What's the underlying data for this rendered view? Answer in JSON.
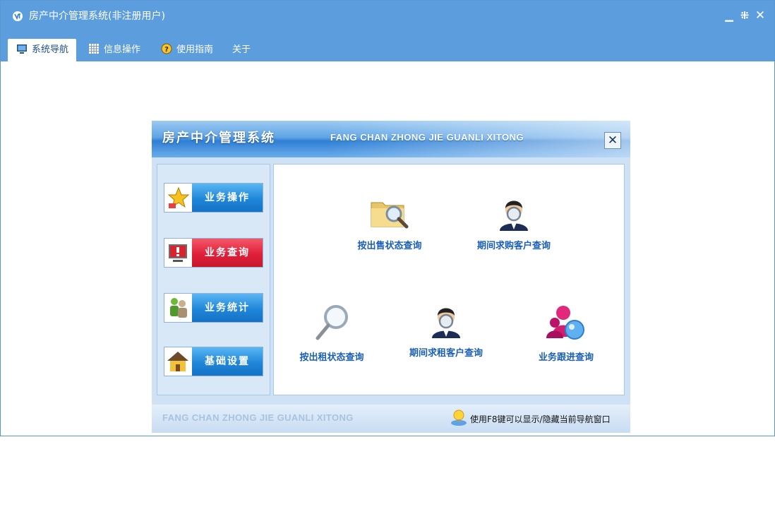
{
  "window": {
    "title": "房产中介管理系统(非注册用户)",
    "controls": {
      "minimize": "▁",
      "restore": "⁜",
      "close": "✕"
    }
  },
  "menu": {
    "tabs": [
      {
        "label": "系统导航",
        "icon": "monitor-icon",
        "active": true
      },
      {
        "label": "信息操作",
        "icon": "grid-icon",
        "active": false
      },
      {
        "label": "使用指南",
        "icon": "help-icon",
        "active": false
      },
      {
        "label": "关于",
        "icon": "",
        "active": false
      }
    ]
  },
  "dialog": {
    "title_cn": "房产中介管理系统",
    "title_en": "FANG CHAN ZHONG JIE GUANLI XITONG",
    "close": "✕",
    "side_buttons": [
      {
        "label": "业务操作",
        "icon": "star-icon",
        "active": false
      },
      {
        "label": "业务查询",
        "icon": "alert-monitor-icon",
        "active": true
      },
      {
        "label": "业务统计",
        "icon": "people-stat-icon",
        "active": false
      },
      {
        "label": "基础设置",
        "icon": "house-icon",
        "active": false
      }
    ],
    "queries": [
      {
        "label": "按出售状态查询",
        "icon": "folder-search-icon"
      },
      {
        "label": "期间求购客户查询",
        "icon": "user-search-icon"
      },
      {
        "label": "按出租状态查询",
        "icon": "magnifier-icon"
      },
      {
        "label": "期间求租客户查询",
        "icon": "user-search-icon"
      },
      {
        "label": "业务跟进查询",
        "icon": "users-icon"
      }
    ],
    "footer_en": "FANG CHAN ZHONG JIE GUANLI XITONG",
    "footer_tip": "使用F8键可以显示/隐藏当前导航窗口"
  },
  "colors": {
    "titlebar": "#5c9edd",
    "link_blue": "#1a5fb4",
    "active_red": "#e0203a",
    "button_blue": "#1f86d9"
  }
}
